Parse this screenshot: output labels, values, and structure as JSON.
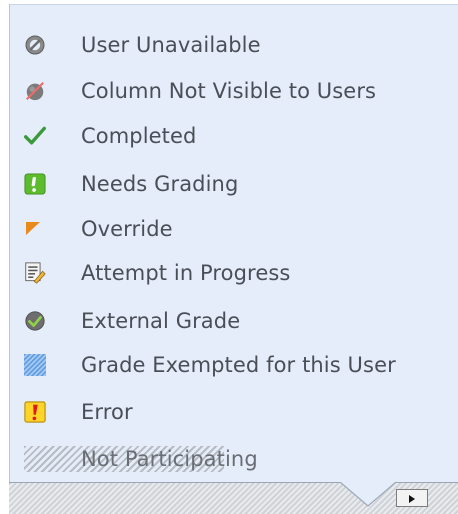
{
  "legend": {
    "items": [
      {
        "label": "User Unavailable",
        "icon": "user-unavailable-icon"
      },
      {
        "label": "Column Not Visible to Users",
        "icon": "column-hidden-icon"
      },
      {
        "label": "Completed",
        "icon": "checkmark-icon"
      },
      {
        "label": "Needs Grading",
        "icon": "needs-grading-icon"
      },
      {
        "label": "Override",
        "icon": "override-flag-icon"
      },
      {
        "label": "Attempt in Progress",
        "icon": "attempt-in-progress-icon"
      },
      {
        "label": "External Grade",
        "icon": "external-grade-icon"
      },
      {
        "label": "Grade Exempted for this User",
        "icon": "grade-exempted-icon"
      },
      {
        "label": "Error",
        "icon": "error-icon"
      },
      {
        "label": "Not Participating",
        "icon": "not-participating-pattern"
      }
    ]
  },
  "colors": {
    "panel_background": "#e5edfa",
    "completed_green": "#3a9a3a",
    "needs_grading_green": "#5dbb2e",
    "override_orange": "#e98a1d",
    "exempted_blue": "#7fb0ea",
    "error_yellow": "#ffd52a",
    "error_red": "#e01b1b"
  },
  "scroll_button": {
    "icon": "play-arrow-icon"
  }
}
